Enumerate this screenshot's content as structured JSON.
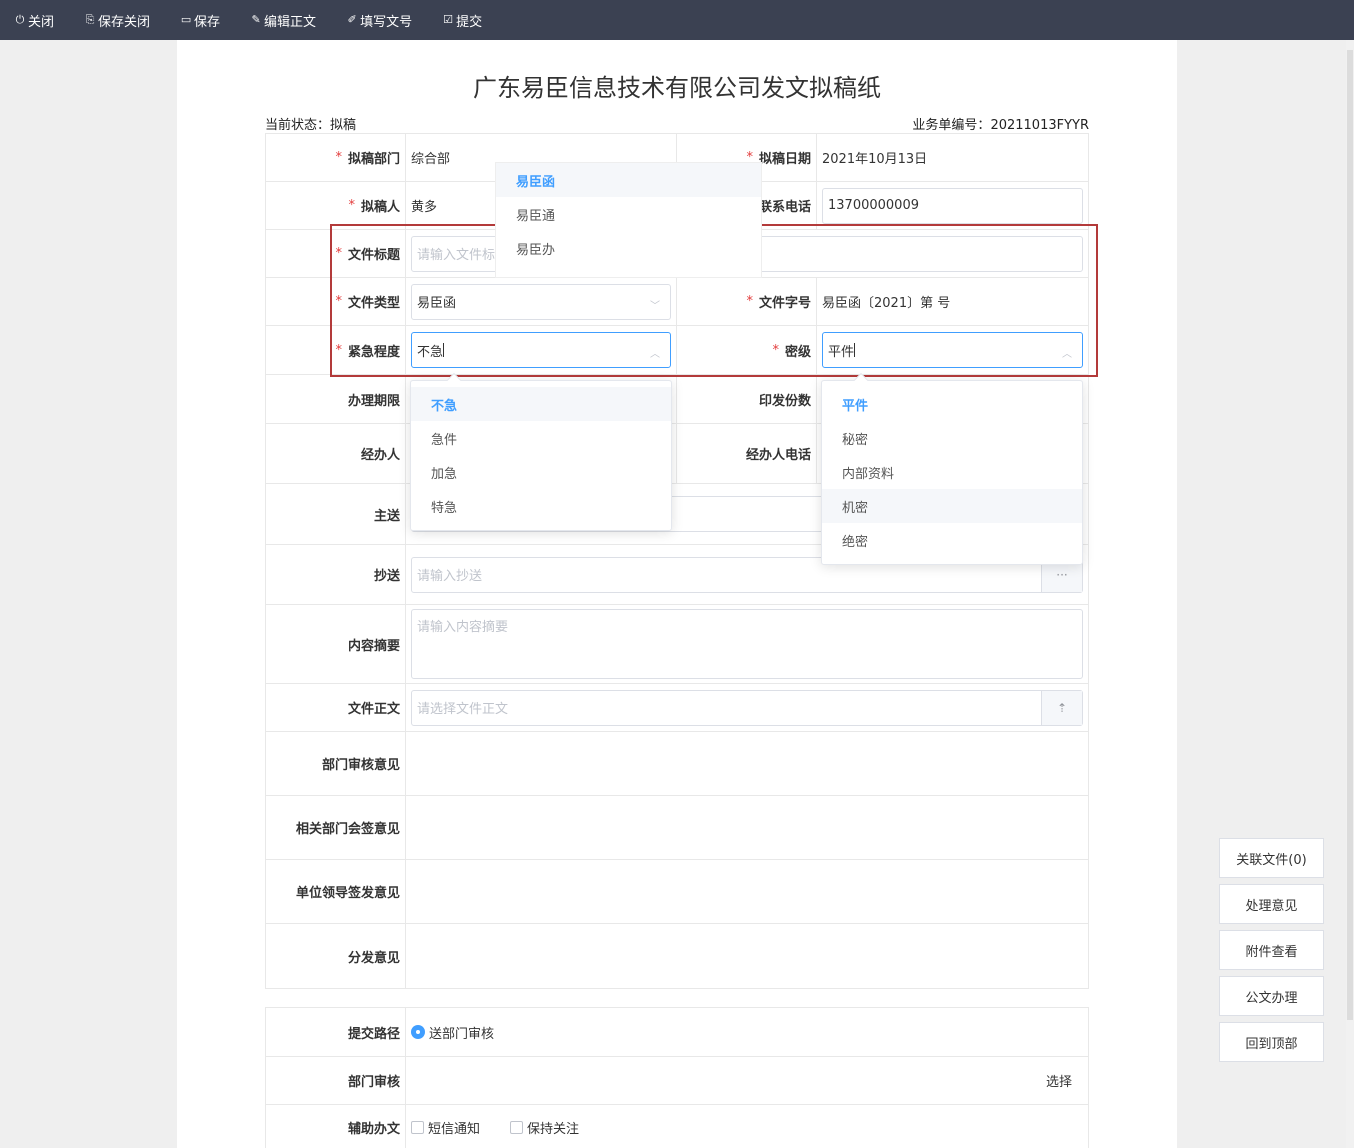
{
  "toolbar": {
    "close": "关闭",
    "save_close": "保存关闭",
    "save": "保存",
    "edit_body": "编辑正文",
    "fill_number": "填写文号",
    "submit": "提交"
  },
  "doc": {
    "title": "广东易臣信息技术有限公司发文拟稿纸",
    "status_label": "当前状态：",
    "status_value": "拟稿",
    "biz_no_label": "业务单编号：",
    "biz_no_value": "20211013FYYR"
  },
  "form": {
    "draft_dept_label": "拟稿部门",
    "draft_dept_value": "综合部",
    "draft_date_label": "拟稿日期",
    "draft_date_value": "2021年10月13日",
    "drafter_label": "拟稿人",
    "drafter_value": "黄多",
    "phone_label": "联系电话",
    "phone_value": "13700000009",
    "title_label": "文件标题",
    "title_placeholder": "请输入文件标",
    "type_label": "文件类型",
    "type_value": "易臣函",
    "number_label": "文件字号",
    "number_value": "易臣函〔2021〕第 号",
    "urgency_label": "紧急程度",
    "urgency_value": "不急",
    "secret_label": "密级",
    "secret_value": "平件",
    "deadline_label": "办理期限",
    "copies_label": "印发份数",
    "handler_label": "经办人",
    "handler_phone_label": "经办人电话",
    "main_send_label": "主送",
    "cc_label": "抄送",
    "cc_placeholder": "请输入抄送",
    "cc_addon": "···",
    "summary_label": "内容摘要",
    "summary_placeholder": "请输入内容摘要",
    "body_label": "文件正文",
    "body_placeholder": "请选择文件正文",
    "dept_review_label": "部门审核意见",
    "cosign_label": "相关部门会签意见",
    "leader_label": "单位领导签发意见",
    "dispatch_label": "分发意见"
  },
  "dropdown_type": [
    "易臣函",
    "易臣通",
    "易臣办"
  ],
  "dropdown_urgency": [
    "不急",
    "急件",
    "加急",
    "特急"
  ],
  "dropdown_secret": [
    "平件",
    "秘密",
    "内部资料",
    "机密",
    "绝密"
  ],
  "submit_form": {
    "path_label": "提交路径",
    "path_option": "送部门审核",
    "dept_review_label": "部门审核",
    "select_link": "选择",
    "assist_label": "辅助办文",
    "sms_label": "短信通知",
    "follow_label": "保持关注"
  },
  "side": {
    "related": "关联文件(0)",
    "opinion": "处理意见",
    "attachments": "附件查看",
    "process": "公文办理",
    "top": "回到顶部"
  },
  "colors": {
    "toolbar_bg": "#3b4152",
    "accent": "#409eff",
    "required": "#e23b3b",
    "highlight": "#b33a3a"
  }
}
